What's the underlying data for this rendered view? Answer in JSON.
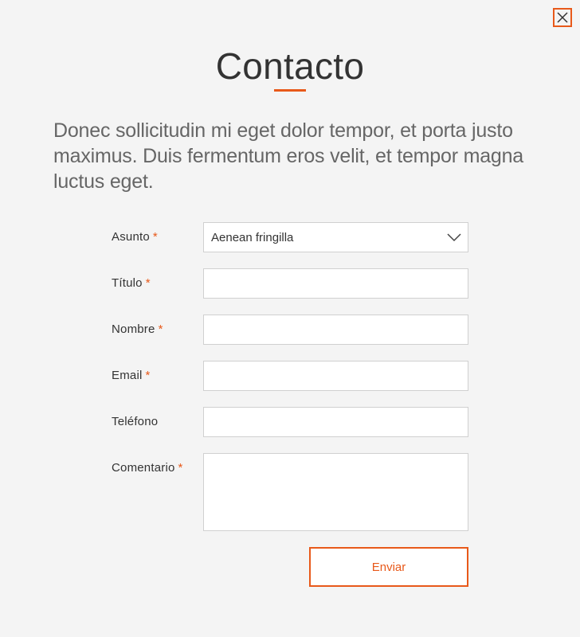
{
  "modal": {
    "title": "Contacto",
    "intro": "Donec sollicitudin mi eget dolor tempor, et porta justo maximus. Duis fermentum eros velit, et tempor magna luctus eget.",
    "accent_color": "#e8591a",
    "close_icon": "close-icon"
  },
  "form": {
    "required_marker": "*",
    "subject": {
      "label": "Asunto",
      "value": "Aenean fringilla",
      "required": true
    },
    "title": {
      "label": "Título",
      "value": "",
      "required": true
    },
    "name": {
      "label": "Nombre",
      "value": "",
      "required": true
    },
    "email": {
      "label": "Email",
      "value": "",
      "required": true
    },
    "phone": {
      "label": "Teléfono",
      "value": "",
      "required": false
    },
    "comment": {
      "label": "Comentario",
      "value": "",
      "required": true
    },
    "submit_label": "Enviar"
  }
}
